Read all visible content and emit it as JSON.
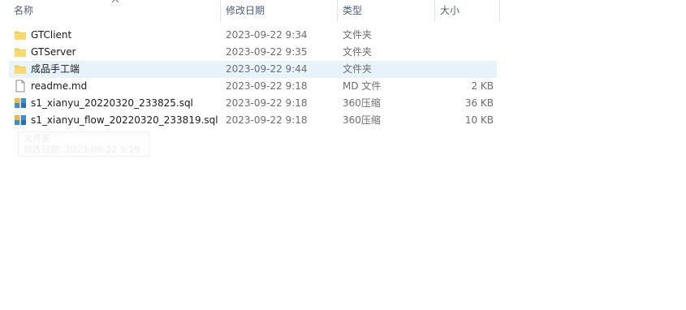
{
  "columns": {
    "name": "名称",
    "date_modified": "修改日期",
    "type": "类型",
    "size": "大小"
  },
  "sort": {
    "column": "name",
    "direction": "ascending"
  },
  "files": [
    {
      "name": "GTClient",
      "date": "2023-09-22 9:34",
      "type": "文件夹",
      "size": "",
      "icon": "folder-icon"
    },
    {
      "name": "GTServer",
      "date": "2023-09-22 9:35",
      "type": "文件夹",
      "size": "",
      "icon": "folder-icon"
    },
    {
      "name": "成品手工端",
      "date": "2023-09-22 9:44",
      "type": "文件夹",
      "size": "",
      "icon": "folder-icon",
      "selected": true
    },
    {
      "name": "readme.md",
      "date": "2023-09-22 9:18",
      "type": "MD 文件",
      "size": "2 KB",
      "icon": "document-icon"
    },
    {
      "name": "s1_xianyu_20220320_233825.sql",
      "date": "2023-09-22 9:18",
      "type": "360压缩",
      "size": "36 KB",
      "icon": "archive-icon"
    },
    {
      "name": "s1_xianyu_flow_20220320_233819.sql",
      "date": "2023-09-22 9:18",
      "type": "360压缩",
      "size": "10 KB",
      "icon": "archive-icon"
    }
  ],
  "tooltip": {
    "line1": "文件夹",
    "line2": "修改日期: 2023-09-22 9:19"
  },
  "colors": {
    "header_text": "#4c607a",
    "selected_row": "#e8f2fb",
    "folder": "#f8c94e",
    "archive": "#3d8fd1"
  }
}
